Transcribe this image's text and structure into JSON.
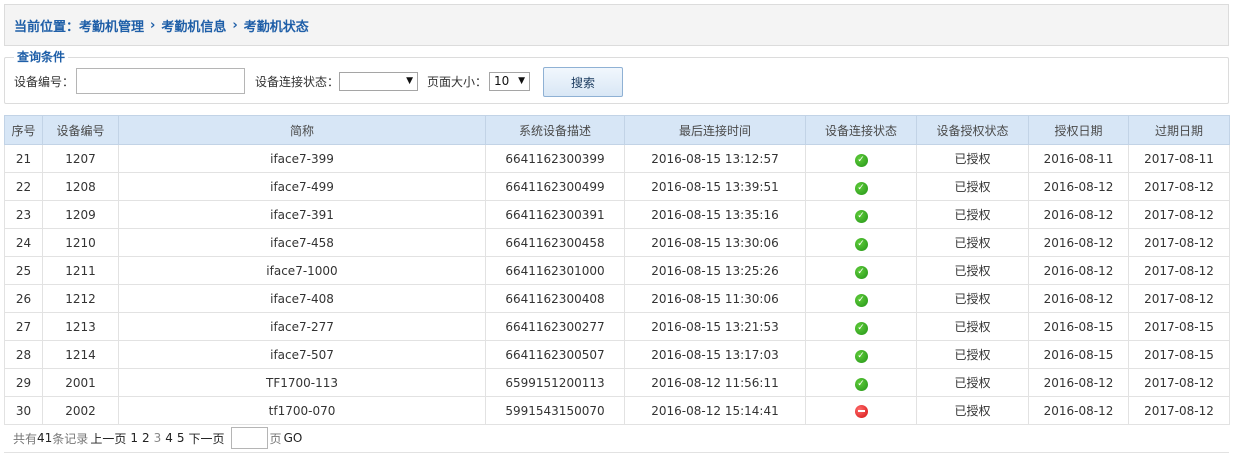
{
  "breadcrumb": {
    "prefix": "当前位置：",
    "items": [
      "考勤机管理",
      "考勤机信息",
      "考勤机状态"
    ],
    "separator": "›"
  },
  "query": {
    "legend": "查询条件",
    "device_no_label": "设备编号：",
    "device_no_value": "",
    "status_label": "设备连接状态：",
    "status_value": "",
    "page_size_label": "页面大小：",
    "page_size_value": "10",
    "search_button": "搜索"
  },
  "table": {
    "columns": [
      "序号",
      "设备编号",
      "简称",
      "系统设备描述",
      "最后连接时间",
      "设备连接状态",
      "设备授权状态",
      "授权日期",
      "过期日期"
    ],
    "rows": [
      {
        "seq": "21",
        "device_no": "1207",
        "name": "iface7-399",
        "desc": "6641162300399",
        "last_conn": "2016-08-15 13:12:57",
        "status": "ok",
        "auth": "已授权",
        "auth_date": "2016-08-11",
        "expire": "2017-08-11"
      },
      {
        "seq": "22",
        "device_no": "1208",
        "name": "iface7-499",
        "desc": "6641162300499",
        "last_conn": "2016-08-15 13:39:51",
        "status": "ok",
        "auth": "已授权",
        "auth_date": "2016-08-12",
        "expire": "2017-08-12"
      },
      {
        "seq": "23",
        "device_no": "1209",
        "name": "iface7-391",
        "desc": "6641162300391",
        "last_conn": "2016-08-15 13:35:16",
        "status": "ok",
        "auth": "已授权",
        "auth_date": "2016-08-12",
        "expire": "2017-08-12"
      },
      {
        "seq": "24",
        "device_no": "1210",
        "name": "iface7-458",
        "desc": "6641162300458",
        "last_conn": "2016-08-15 13:30:06",
        "status": "ok",
        "auth": "已授权",
        "auth_date": "2016-08-12",
        "expire": "2017-08-12"
      },
      {
        "seq": "25",
        "device_no": "1211",
        "name": "iface7-1000",
        "desc": "6641162301000",
        "last_conn": "2016-08-15 13:25:26",
        "status": "ok",
        "auth": "已授权",
        "auth_date": "2016-08-12",
        "expire": "2017-08-12"
      },
      {
        "seq": "26",
        "device_no": "1212",
        "name": "iface7-408",
        "desc": "6641162300408",
        "last_conn": "2016-08-15 11:30:06",
        "status": "ok",
        "auth": "已授权",
        "auth_date": "2016-08-12",
        "expire": "2017-08-12"
      },
      {
        "seq": "27",
        "device_no": "1213",
        "name": "iface7-277",
        "desc": "6641162300277",
        "last_conn": "2016-08-15 13:21:53",
        "status": "ok",
        "auth": "已授权",
        "auth_date": "2016-08-15",
        "expire": "2017-08-15"
      },
      {
        "seq": "28",
        "device_no": "1214",
        "name": "iface7-507",
        "desc": "6641162300507",
        "last_conn": "2016-08-15 13:17:03",
        "status": "ok",
        "auth": "已授权",
        "auth_date": "2016-08-15",
        "expire": "2017-08-15"
      },
      {
        "seq": "29",
        "device_no": "2001",
        "name": "TF1700-113",
        "desc": "6599151200113",
        "last_conn": "2016-08-12 11:56:11",
        "status": "ok",
        "auth": "已授权",
        "auth_date": "2016-08-12",
        "expire": "2017-08-12"
      },
      {
        "seq": "30",
        "device_no": "2002",
        "name": "tf1700-070",
        "desc": "5991543150070",
        "last_conn": "2016-08-12 15:14:41",
        "status": "error",
        "auth": "已授权",
        "auth_date": "2016-08-12",
        "expire": "2017-08-12"
      }
    ]
  },
  "pager": {
    "total_prefix": "共有",
    "total_count": "41",
    "total_suffix": "条记录",
    "prev": "上一页",
    "pages": [
      "1",
      "2",
      "3",
      "4",
      "5"
    ],
    "current_page": "3",
    "next": "下一页",
    "page_input_value": "",
    "page_unit": "页",
    "go": "GO"
  },
  "colors": {
    "accent": "#1f5fa8",
    "header_bg": "#d7e6f6",
    "ok": "#2e9e1f",
    "error": "#d41313"
  }
}
